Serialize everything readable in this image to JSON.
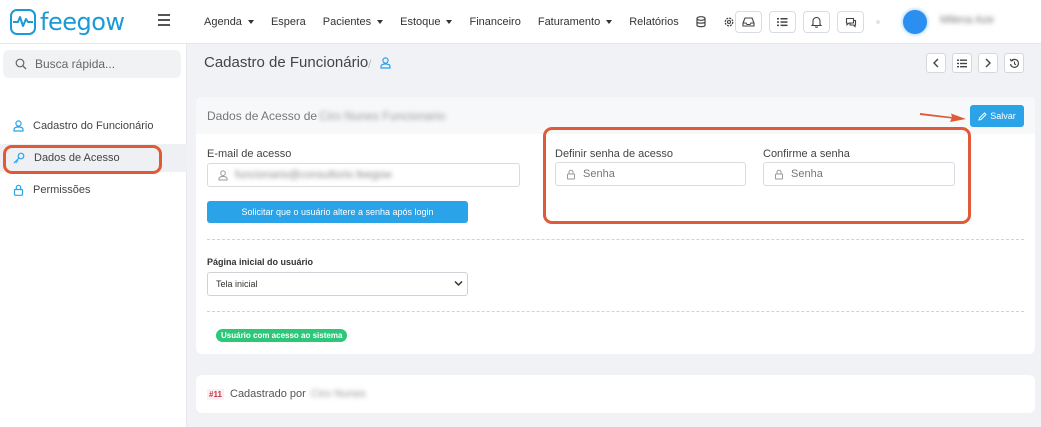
{
  "brand": {
    "name": "feegow",
    "color": "#1a9ad6"
  },
  "nav": {
    "items": [
      {
        "label": "Agenda",
        "dropdown": true
      },
      {
        "label": "Espera",
        "dropdown": false
      },
      {
        "label": "Pacientes",
        "dropdown": true
      },
      {
        "label": "Estoque",
        "dropdown": true
      },
      {
        "label": "Financeiro",
        "dropdown": false
      },
      {
        "label": "Faturamento",
        "dropdown": true
      },
      {
        "label": "Relatórios",
        "dropdown": false
      }
    ],
    "icons": [
      "database-icon",
      "gear-icon"
    ],
    "action_icons": [
      "inbox-icon",
      "list-icon",
      "bell-icon",
      "chat-icon"
    ],
    "user_name": "Milena Azevedo"
  },
  "sidebar": {
    "search_placeholder": "Busca rápida...",
    "items": [
      {
        "label": "Cadastro do Funcionário",
        "icon": "user-icon",
        "active": false
      },
      {
        "label": "Dados de Acesso",
        "icon": "key-icon",
        "active": true
      },
      {
        "label": "Permissões",
        "icon": "lock-icon",
        "active": false
      }
    ]
  },
  "header": {
    "title": "Cadastro de Funcionário",
    "separator": "/"
  },
  "card": {
    "title": "Dados de Acesso de",
    "person_name": "Ciro Nunes Funcionario",
    "save_label": "Salvar",
    "email_label": "E-mail de acesso",
    "email_value": "funcionario@consultorio.feegow",
    "password_label": "Definir senha de acesso",
    "password_placeholder": "Senha",
    "confirm_label": "Confirme a senha",
    "confirm_placeholder": "Senha",
    "request_button": "Solicitar que o usuário altere a senha após login",
    "home_label": "Página inicial do usuário",
    "home_value": "Tela inicial",
    "access_badge": "Usuário com acesso ao sistema"
  },
  "footer_card": {
    "id": "#11",
    "registered_by": "Cadastrado por",
    "registered_name": "Ciro Nunes"
  },
  "colors": {
    "primary": "#2aa3e8",
    "success": "#2dc779",
    "annotation": "#e05a38"
  }
}
